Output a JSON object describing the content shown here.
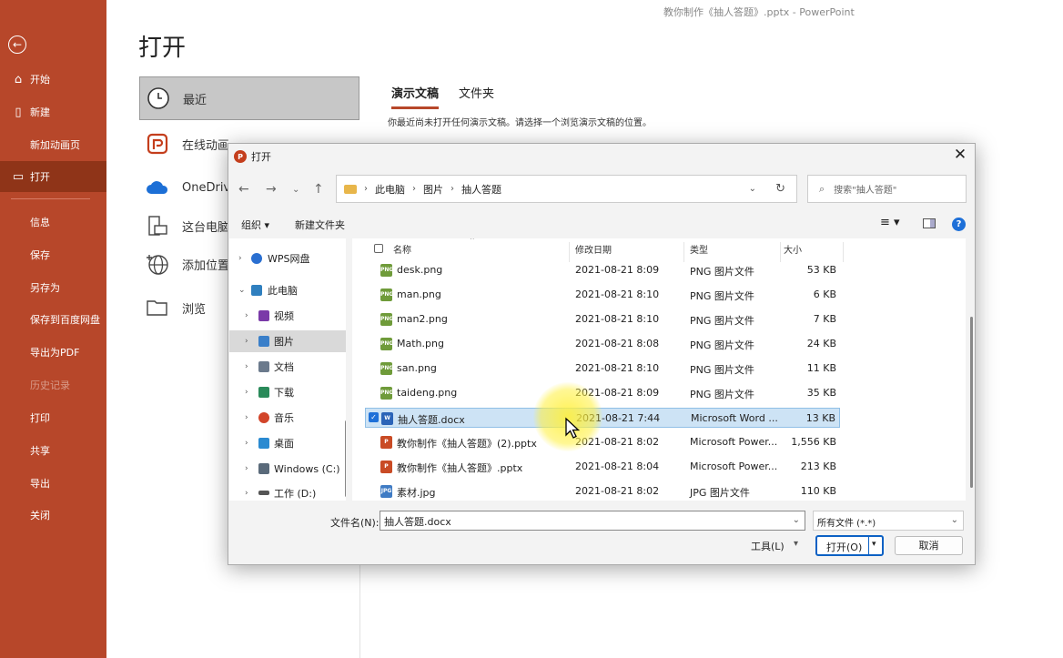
{
  "app": {
    "title": "教你制作《抽人答题》.pptx  -  PowerPoint"
  },
  "sidebar": {
    "items": [
      {
        "label": "开始",
        "icon": "home-icon"
      },
      {
        "label": "新建",
        "icon": "new-file-icon"
      },
      {
        "label": "新加动画页",
        "icon": ""
      },
      {
        "label": "打开",
        "icon": "open-folder-icon"
      },
      {
        "label": "信息"
      },
      {
        "label": "保存"
      },
      {
        "label": "另存为"
      },
      {
        "label": "保存到百度网盘"
      },
      {
        "label": "导出为PDF"
      },
      {
        "label": "历史记录"
      },
      {
        "label": "打印"
      },
      {
        "label": "共享"
      },
      {
        "label": "导出"
      },
      {
        "label": "关闭"
      }
    ]
  },
  "main": {
    "title": "打开",
    "locations": [
      {
        "label": "最近",
        "icon": "clock-icon"
      },
      {
        "label": "在线动画",
        "icon": "online-animation-icon"
      },
      {
        "label": "OneDrive",
        "icon": "onedrive-cloud-icon"
      },
      {
        "label": "这台电脑",
        "icon": "computer-icon"
      },
      {
        "label": "添加位置",
        "icon": "globe-add-icon"
      },
      {
        "label": "浏览",
        "icon": "browse-folder-icon"
      }
    ],
    "tabs": [
      {
        "label": "演示文稿"
      },
      {
        "label": "文件夹"
      }
    ],
    "hint": "你最近尚未打开任何演示文稿。请选择一个浏览演示文稿的位置。"
  },
  "dialog": {
    "title": "打开",
    "breadcrumb": [
      "此电脑",
      "图片",
      "抽人答题"
    ],
    "search_placeholder": "搜索\"抽人答题\"",
    "organize": "组织 ▾",
    "new_folder": "新建文件夹",
    "tree": [
      {
        "label": "WPS网盘",
        "color": "#2a6fd1"
      },
      {
        "label": "此电脑",
        "color": "#2f7fbf"
      },
      {
        "label": "视频",
        "color": "#7a3aa8"
      },
      {
        "label": "图片",
        "color": "#3a7fc9"
      },
      {
        "label": "文档",
        "color": "#6b7a8c"
      },
      {
        "label": "下载",
        "color": "#2a8a5a"
      },
      {
        "label": "音乐",
        "color": "#d2452a"
      },
      {
        "label": "桌面",
        "color": "#2a8ad1"
      },
      {
        "label": "Windows (C:)",
        "color": "#5a6a7a"
      },
      {
        "label": "工作 (D:)",
        "color": "#555555"
      }
    ],
    "columns": {
      "name": "名称",
      "date": "修改日期",
      "type": "类型",
      "size": "大小"
    },
    "files": [
      {
        "name": "desk.png",
        "date": "2021-08-21 8:09",
        "type": "PNG 图片文件",
        "size": "53 KB",
        "kind": "png"
      },
      {
        "name": "man.png",
        "date": "2021-08-21 8:10",
        "type": "PNG 图片文件",
        "size": "6 KB",
        "kind": "png"
      },
      {
        "name": "man2.png",
        "date": "2021-08-21 8:10",
        "type": "PNG 图片文件",
        "size": "7 KB",
        "kind": "png"
      },
      {
        "name": "Math.png",
        "date": "2021-08-21 8:08",
        "type": "PNG 图片文件",
        "size": "24 KB",
        "kind": "png"
      },
      {
        "name": "san.png",
        "date": "2021-08-21 8:10",
        "type": "PNG 图片文件",
        "size": "11 KB",
        "kind": "png"
      },
      {
        "name": "taideng.png",
        "date": "2021-08-21 8:09",
        "type": "PNG 图片文件",
        "size": "35 KB",
        "kind": "png"
      },
      {
        "name": "抽人答题.docx",
        "date": "2021-08-21 7:44",
        "type": "Microsoft Word ...",
        "size": "13 KB",
        "kind": "docx"
      },
      {
        "name": "教你制作《抽人答题》(2).pptx",
        "date": "2021-08-21 8:02",
        "type": "Microsoft Power...",
        "size": "1,556 KB",
        "kind": "pptx"
      },
      {
        "name": "教你制作《抽人答题》.pptx",
        "date": "2021-08-21 8:04",
        "type": "Microsoft Power...",
        "size": "213 KB",
        "kind": "pptx"
      },
      {
        "name": "素材.jpg",
        "date": "2021-08-21 8:02",
        "type": "JPG 图片文件",
        "size": "110 KB",
        "kind": "jpg"
      }
    ],
    "filename_label": "文件名(N):",
    "filename_value": "抽人答题.docx",
    "filetype_value": "所有文件 (*.*)",
    "tools_label": "工具(L)",
    "open_label": "打开(O)",
    "cancel_label": "取消"
  }
}
